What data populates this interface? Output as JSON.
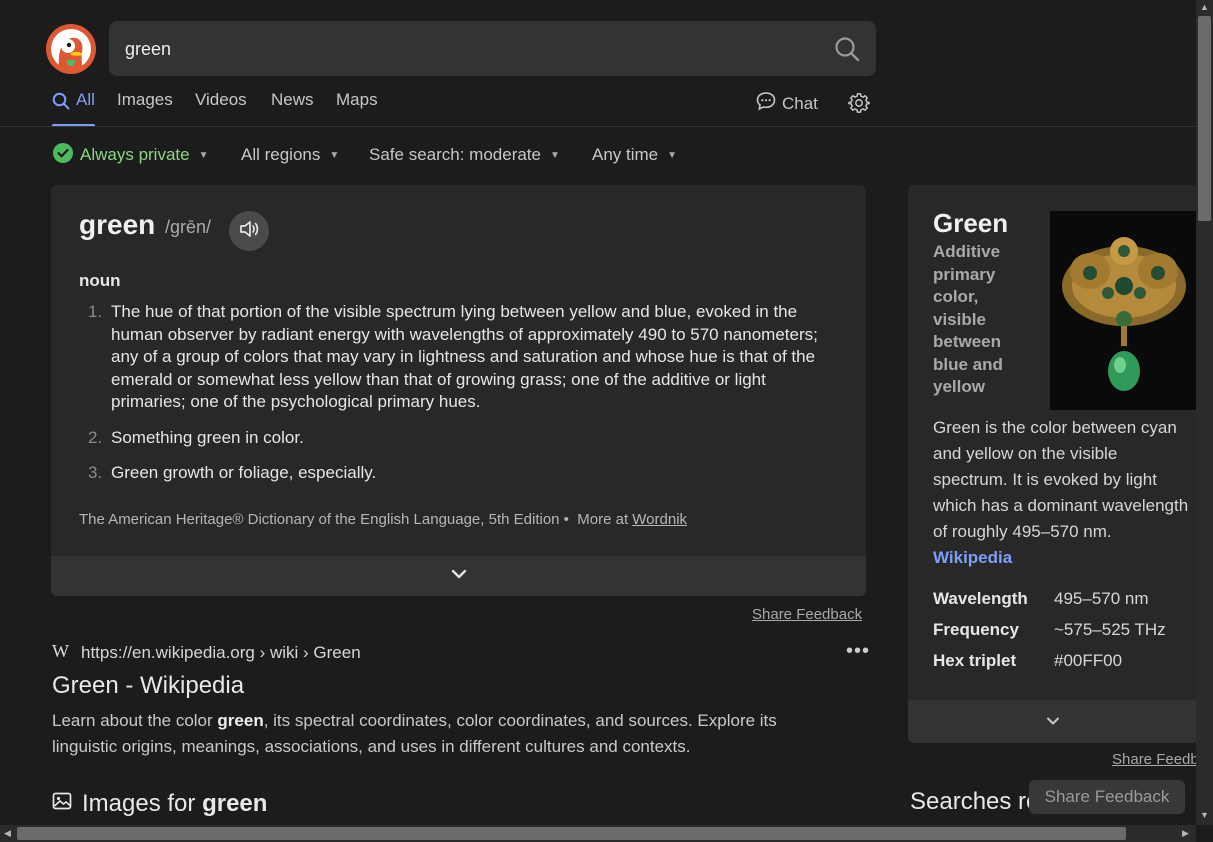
{
  "search": {
    "query": "green"
  },
  "tabs": [
    {
      "label": "All",
      "active": true
    },
    {
      "label": "Images"
    },
    {
      "label": "Videos"
    },
    {
      "label": "News"
    },
    {
      "label": "Maps"
    }
  ],
  "header": {
    "chat_label": "Chat"
  },
  "filters": {
    "privacy": "Always private",
    "region": "All regions",
    "safe_search": "Safe search: moderate",
    "time": "Any time"
  },
  "definition": {
    "word": "green",
    "pronunciation": "/grēn/",
    "part_of_speech": "noun",
    "senses": [
      {
        "num": "1.",
        "text": "The hue of that portion of the visible spectrum lying between yellow and blue, evoked in the human observer by radiant energy with wavelengths of approximately 490 to 570 nanometers; any of a group of colors that may vary in lightness and saturation and whose hue is that of the emerald or somewhat less yellow than that of growing grass; one of the additive or light primaries; one of the psychological primary hues."
      },
      {
        "num": "2.",
        "text": "Something green in color."
      },
      {
        "num": "3.",
        "text": "Green growth or foliage, especially."
      }
    ],
    "source": "The American Heritage® Dictionary of the English Language, 5th Edition",
    "more_at": "More at",
    "more_link": "Wordnik"
  },
  "share_feedback": "Share Feedback",
  "result": {
    "favicon": "W",
    "url": "https://en.wikipedia.org › wiki › Green",
    "title": "Green - Wikipedia",
    "snippet_before": "Learn about the color ",
    "snippet_bold": "green",
    "snippet_after": ", its spectral coordinates, color coordinates, and sources. Explore its linguistic origins, meanings, associations, and uses in different cultures and contexts."
  },
  "images_section": {
    "prefix": "Images for",
    "term": "green"
  },
  "knowledge_panel": {
    "title": "Green",
    "subtitle": "Additive primary color, visible between blue and yellow",
    "description": "Green is the color between cyan and yellow on the visible spectrum. It is evoked by light which has a dominant wavelength of roughly 495–570 nm.",
    "link": "Wikipedia",
    "facts": [
      {
        "key": "Wavelength",
        "value": "495–570 nm"
      },
      {
        "key": "Frequency",
        "value": "~575–525 THz"
      },
      {
        "key": "Hex triplet",
        "value": "#00FF00"
      }
    ],
    "share_feedback": "Share Feedb"
  },
  "searches_related": "Searches re",
  "floating_feedback": "Share Feedback",
  "colors": {
    "accent": "#7f9ef8",
    "private_green": "#8fd484",
    "logo": "#de5833"
  }
}
